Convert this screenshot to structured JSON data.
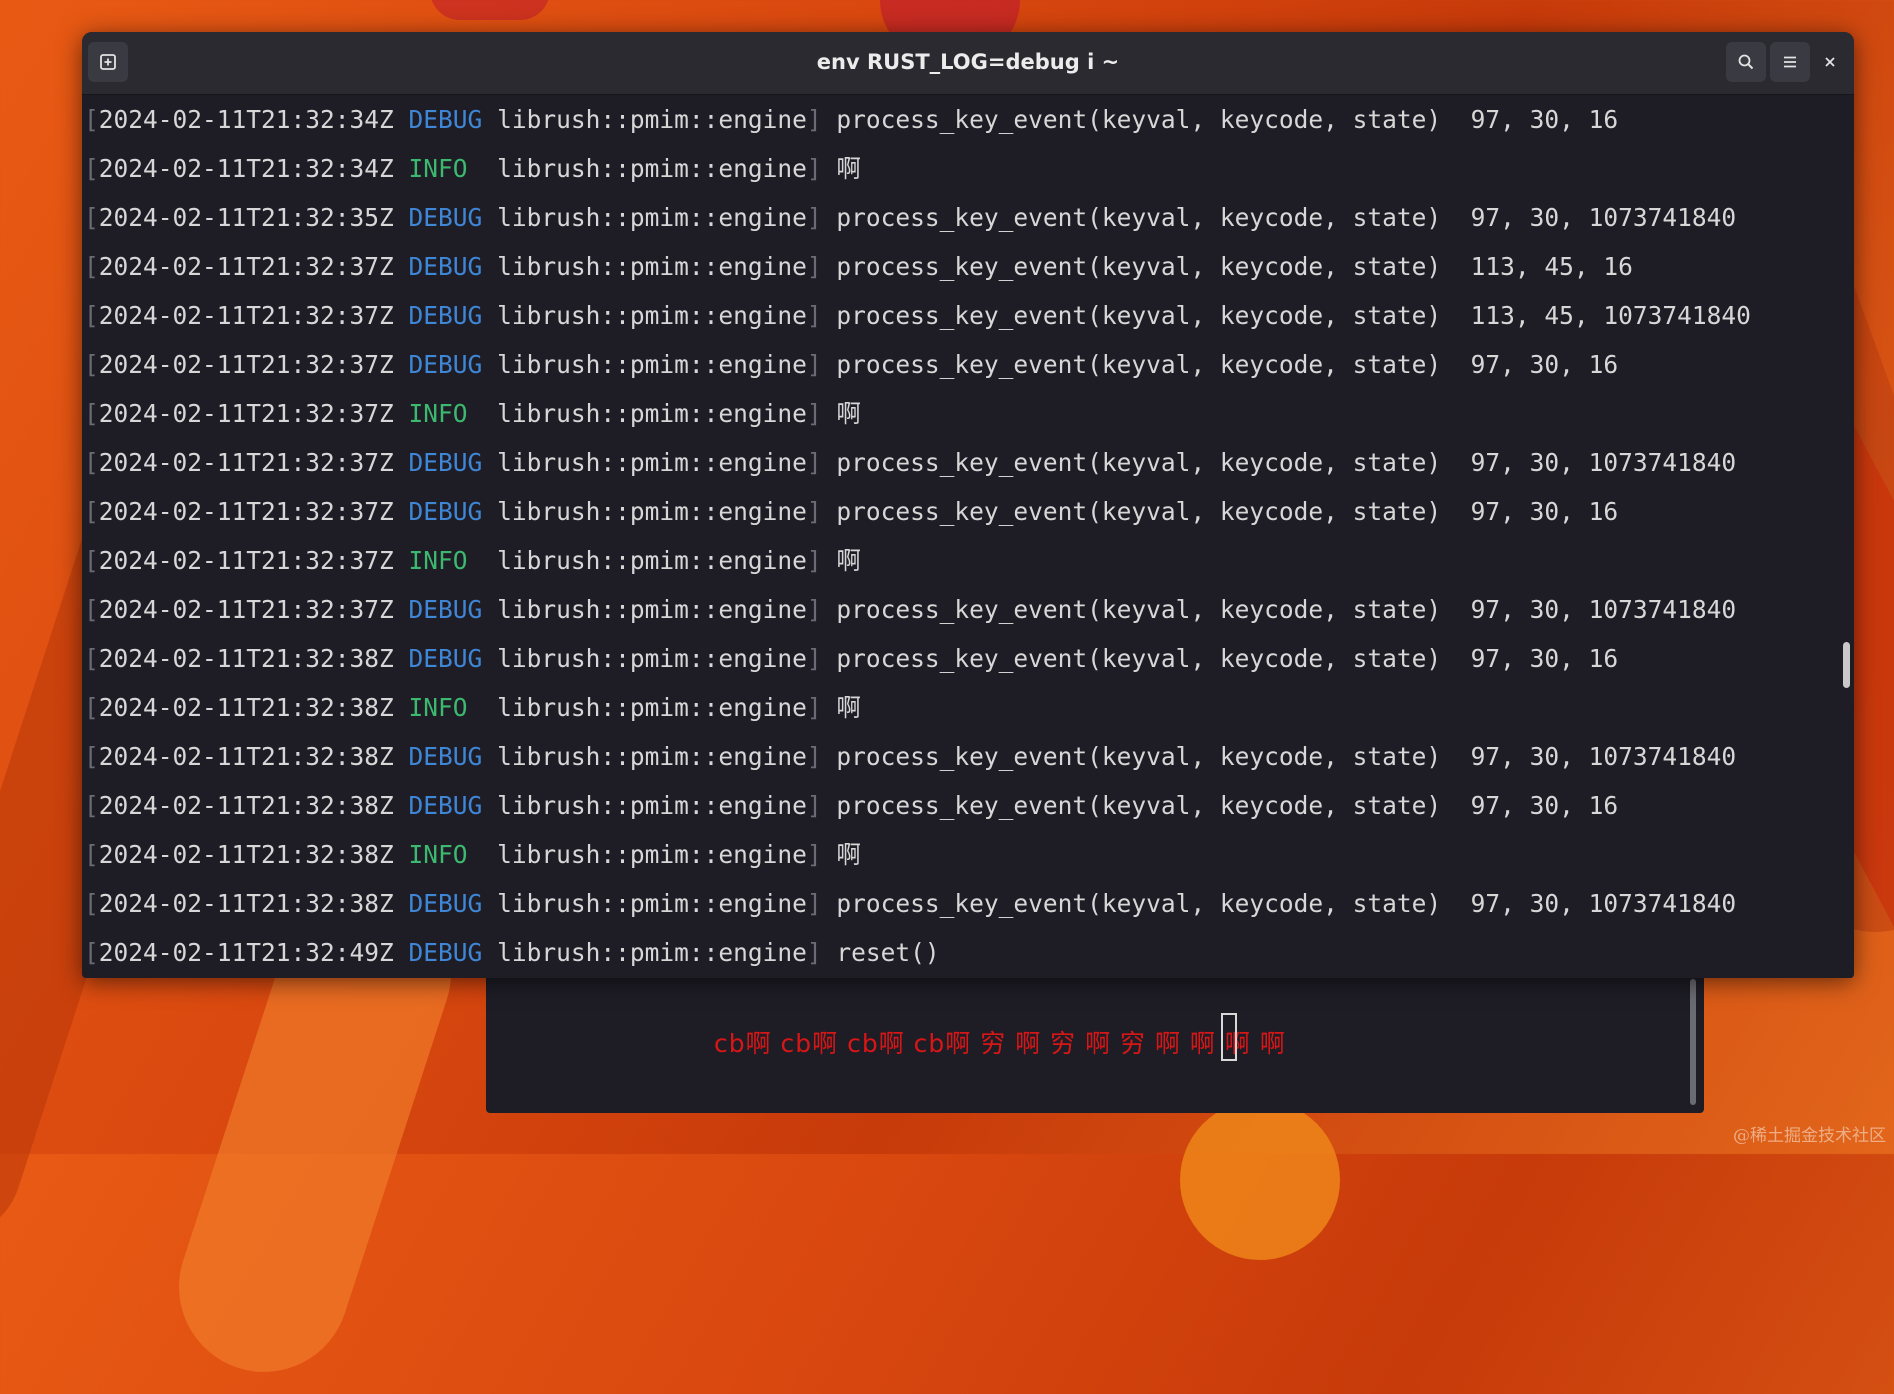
{
  "window": {
    "title": "env RUST_LOG=debug i ~",
    "icons": {
      "new_tab": "new-tab-icon",
      "search": "search-icon",
      "menu": "hamburger-menu-icon",
      "close": "close-icon"
    }
  },
  "log_lines": [
    {
      "ts": "2024-02-11T21:32:34Z",
      "level": "DEBUG",
      "target": "librush::pmim::engine",
      "msg": "process_key_event(keyval, keycode, state)  97, 30, 16"
    },
    {
      "ts": "2024-02-11T21:32:34Z",
      "level": "INFO",
      "target": "librush::pmim::engine",
      "msg": "啊"
    },
    {
      "ts": "2024-02-11T21:32:35Z",
      "level": "DEBUG",
      "target": "librush::pmim::engine",
      "msg": "process_key_event(keyval, keycode, state)  97, 30, 1073741840"
    },
    {
      "ts": "2024-02-11T21:32:37Z",
      "level": "DEBUG",
      "target": "librush::pmim::engine",
      "msg": "process_key_event(keyval, keycode, state)  113, 45, 16"
    },
    {
      "ts": "2024-02-11T21:32:37Z",
      "level": "DEBUG",
      "target": "librush::pmim::engine",
      "msg": "process_key_event(keyval, keycode, state)  113, 45, 1073741840"
    },
    {
      "ts": "2024-02-11T21:32:37Z",
      "level": "DEBUG",
      "target": "librush::pmim::engine",
      "msg": "process_key_event(keyval, keycode, state)  97, 30, 16"
    },
    {
      "ts": "2024-02-11T21:32:37Z",
      "level": "INFO",
      "target": "librush::pmim::engine",
      "msg": "啊"
    },
    {
      "ts": "2024-02-11T21:32:37Z",
      "level": "DEBUG",
      "target": "librush::pmim::engine",
      "msg": "process_key_event(keyval, keycode, state)  97, 30, 1073741840"
    },
    {
      "ts": "2024-02-11T21:32:37Z",
      "level": "DEBUG",
      "target": "librush::pmim::engine",
      "msg": "process_key_event(keyval, keycode, state)  97, 30, 16"
    },
    {
      "ts": "2024-02-11T21:32:37Z",
      "level": "INFO",
      "target": "librush::pmim::engine",
      "msg": "啊"
    },
    {
      "ts": "2024-02-11T21:32:37Z",
      "level": "DEBUG",
      "target": "librush::pmim::engine",
      "msg": "process_key_event(keyval, keycode, state)  97, 30, 1073741840"
    },
    {
      "ts": "2024-02-11T21:32:38Z",
      "level": "DEBUG",
      "target": "librush::pmim::engine",
      "msg": "process_key_event(keyval, keycode, state)  97, 30, 16"
    },
    {
      "ts": "2024-02-11T21:32:38Z",
      "level": "INFO",
      "target": "librush::pmim::engine",
      "msg": "啊"
    },
    {
      "ts": "2024-02-11T21:32:38Z",
      "level": "DEBUG",
      "target": "librush::pmim::engine",
      "msg": "process_key_event(keyval, keycode, state)  97, 30, 1073741840"
    },
    {
      "ts": "2024-02-11T21:32:38Z",
      "level": "DEBUG",
      "target": "librush::pmim::engine",
      "msg": "process_key_event(keyval, keycode, state)  97, 30, 16"
    },
    {
      "ts": "2024-02-11T21:32:38Z",
      "level": "INFO",
      "target": "librush::pmim::engine",
      "msg": "啊"
    },
    {
      "ts": "2024-02-11T21:32:38Z",
      "level": "DEBUG",
      "target": "librush::pmim::engine",
      "msg": "process_key_event(keyval, keycode, state)  97, 30, 1073741840"
    },
    {
      "ts": "2024-02-11T21:32:49Z",
      "level": "DEBUG",
      "target": "librush::pmim::engine",
      "msg": "reset()"
    }
  ],
  "ime": {
    "preedit_text": "cb啊 cb啊 cb啊 cb啊 穷 啊 穷 啊 穷 啊 啊 啊 啊"
  },
  "watermark": "@稀土掘金技术社区",
  "colors": {
    "debug": "#3f86d6",
    "info": "#3cb96f",
    "ime_text": "#d81616",
    "terminal_bg": "#1e1d26"
  }
}
